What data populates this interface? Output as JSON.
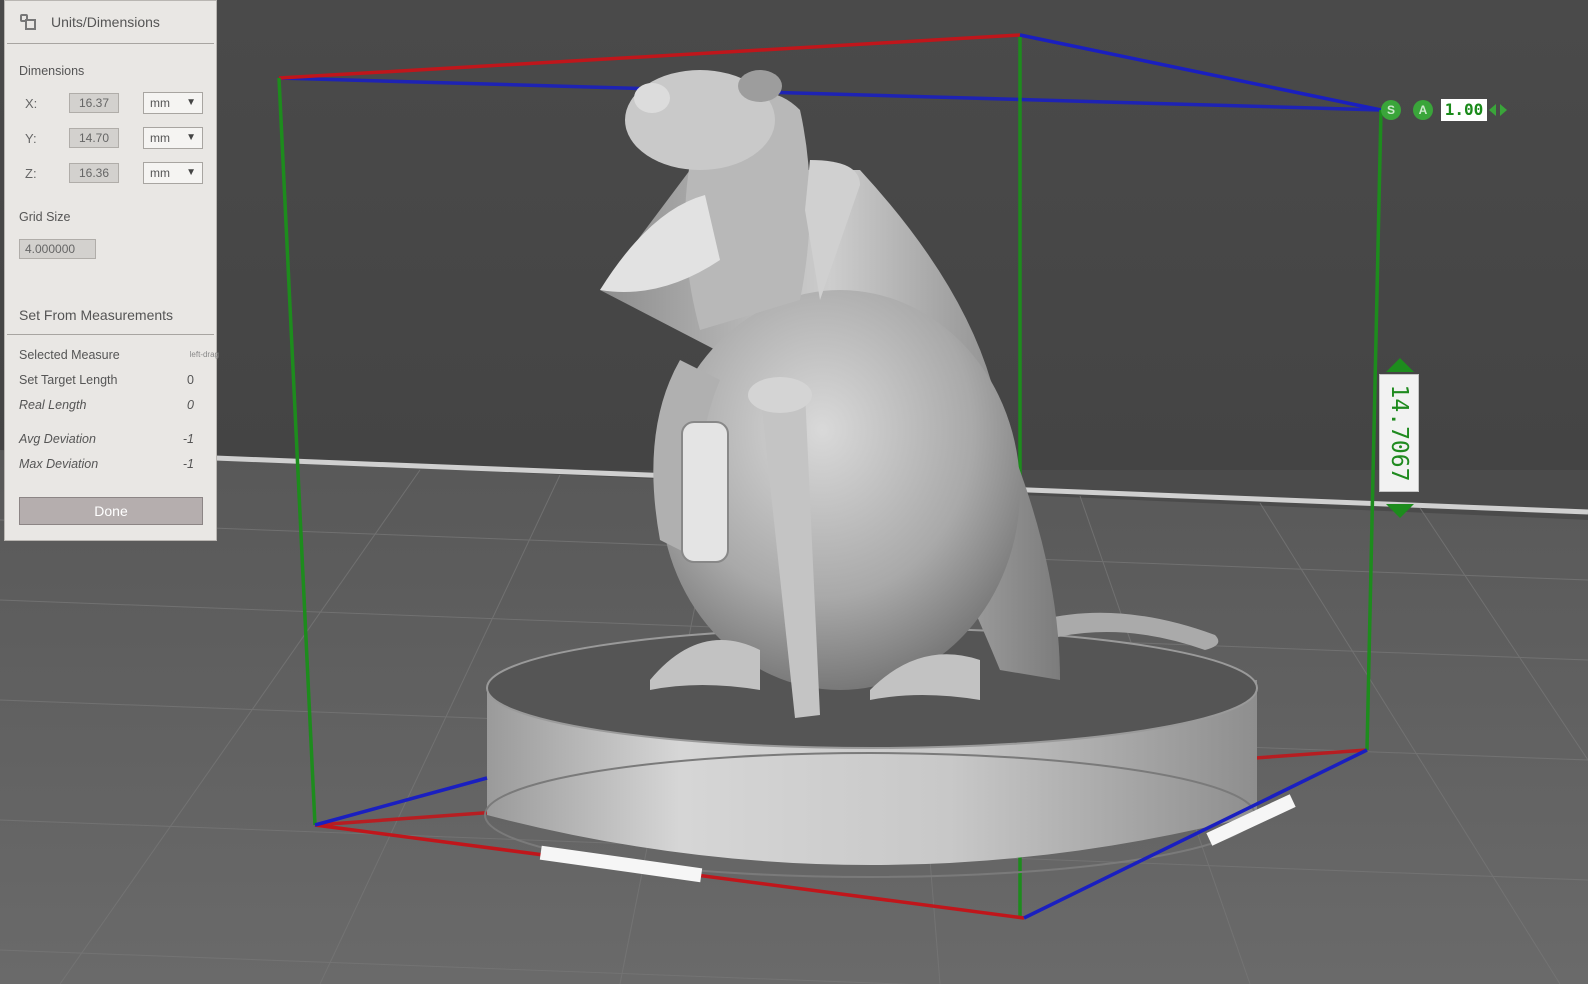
{
  "panel": {
    "title": "Units/Dimensions",
    "dimensions_label": "Dimensions",
    "rows": [
      {
        "axis": "X:",
        "value": "16.37",
        "unit": "mm"
      },
      {
        "axis": "Y:",
        "value": "14.70",
        "unit": "mm"
      },
      {
        "axis": "Z:",
        "value": "16.36",
        "unit": "mm"
      }
    ],
    "grid_size_label": "Grid Size",
    "grid_size_value": "4.000000",
    "set_from_measurements_label": "Set From Measurements",
    "selected_measure_label": "Selected Measure",
    "selected_measure_hint": "left-drag",
    "set_target_length_label": "Set Target Length",
    "set_target_length_value": "0",
    "real_length_label": "Real Length",
    "real_length_value": "0",
    "avg_deviation_label": "Avg Deviation",
    "avg_deviation_value": "-1",
    "max_deviation_label": "Max Deviation",
    "max_deviation_value": "-1",
    "done_label": "Done"
  },
  "viewport": {
    "scale_buttons": [
      "S",
      "A"
    ],
    "scale_value": "1.00",
    "height_measure": "14.7067",
    "colors": {
      "background": "#4b4b4b",
      "x_axis": "#c0161b",
      "y_axis": "#1a1fc0",
      "z_axis": "#1d8c1d",
      "accent_green": "#3aa53a"
    }
  }
}
